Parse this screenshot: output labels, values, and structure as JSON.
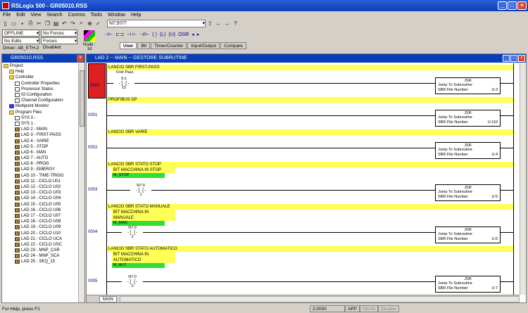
{
  "app": {
    "title": "RSLogix 500 - GR05010.RSS"
  },
  "menu": [
    "File",
    "Edit",
    "View",
    "Search",
    "Comms",
    "Tools",
    "Window",
    "Help"
  ],
  "toolbar": {
    "address": "N7:97/7"
  },
  "status": {
    "mode": "OFFLINE",
    "forces": "No Forces",
    "edits": "No Edits",
    "forces_state": "Forces Disabled",
    "node": "Node : 1d",
    "driver": "Driver: AB_ETH-2"
  },
  "instr_tabs": [
    "User",
    "Bit",
    "Timer/Counter",
    "Input/Output",
    "Compare"
  ],
  "project": {
    "title": "GR05010.RSS",
    "items": [
      {
        "label": "Project",
        "icon": "folder",
        "indent": 0
      },
      {
        "label": "Help",
        "icon": "folder",
        "indent": 1
      },
      {
        "label": "Controller",
        "icon": "folder",
        "indent": 1
      },
      {
        "label": "Controller Properties",
        "icon": "file",
        "indent": 2
      },
      {
        "label": "Processor Status",
        "icon": "file",
        "indent": 2
      },
      {
        "label": "IO Configuration",
        "icon": "file",
        "indent": 2
      },
      {
        "label": "Channel Configuration",
        "icon": "file",
        "indent": 2
      },
      {
        "label": "Multipoint Monitor",
        "icon": "mon",
        "indent": 1
      },
      {
        "label": "Program Files",
        "icon": "folder",
        "indent": 1
      },
      {
        "label": "SYS 0 -",
        "icon": "file",
        "indent": 2
      },
      {
        "label": "SYS 1 -",
        "icon": "file",
        "indent": 2
      },
      {
        "label": "LAD 2 - MAIN",
        "icon": "lad",
        "indent": 2
      },
      {
        "label": "LAD 3 - FIRST-PASS",
        "icon": "lad",
        "indent": 2
      },
      {
        "label": "LAD 4 - VARIE",
        "icon": "lad",
        "indent": 2
      },
      {
        "label": "LAD 5 - STOP",
        "icon": "lad",
        "indent": 2
      },
      {
        "label": "LAD 6 - MAN",
        "icon": "lad",
        "indent": 2
      },
      {
        "label": "LAD 7 - AUTO",
        "icon": "lad",
        "indent": 2
      },
      {
        "label": "LAD 8 - PROG",
        "icon": "lad",
        "indent": 2
      },
      {
        "label": "LAD 9 - EMERGY",
        "icon": "lad",
        "indent": 2
      },
      {
        "label": "LAD 10 - TIME-TRIGG",
        "icon": "lad",
        "indent": 2
      },
      {
        "label": "LAD 11 - CICLO U01",
        "icon": "lad",
        "indent": 2
      },
      {
        "label": "LAD 12 - CICLO U02",
        "icon": "lad",
        "indent": 2
      },
      {
        "label": "LAD 13 - CICLO U03",
        "icon": "lad",
        "indent": 2
      },
      {
        "label": "LAD 14 - CICLO U04",
        "icon": "lad",
        "indent": 2
      },
      {
        "label": "LAD 15 - CICLO U05",
        "icon": "lad",
        "indent": 2
      },
      {
        "label": "LAD 16 - CICLO U06",
        "icon": "lad",
        "indent": 2
      },
      {
        "label": "LAD 17 - CICLO U07",
        "icon": "lad",
        "indent": 2
      },
      {
        "label": "LAD 18 - CICLO U08",
        "icon": "lad",
        "indent": 2
      },
      {
        "label": "LAD 19 - CICLO U09",
        "icon": "lad",
        "indent": 2
      },
      {
        "label": "LAD 20 - CICLO U10",
        "icon": "lad",
        "indent": 2
      },
      {
        "label": "LAD 21 - CICLO UCA",
        "icon": "lad",
        "indent": 2
      },
      {
        "label": "LAD 22 - CICLO USC",
        "icon": "lad",
        "indent": 2
      },
      {
        "label": "LAD 23 - MNP_CAR",
        "icon": "lad",
        "indent": 2
      },
      {
        "label": "LAD 24 - MNP_SCA",
        "icon": "lad",
        "indent": 2
      },
      {
        "label": "LAD 25 - SEQ_15",
        "icon": "lad",
        "indent": 2
      }
    ]
  },
  "ladder": {
    "title": "LAD 2 -- MAIN -- GESTORE SUBRUTINE",
    "jsr_head": "JSR",
    "jsr_label": "Jump To Subroutine",
    "sbr_label": "SBR File Number",
    "rungs": [
      {
        "num": "0000",
        "comment": "LANCIO SBR FIRST-PASS",
        "contact_desc": "First Pass",
        "contact_addr": "S:1",
        "contact_bit": "15",
        "sbr": "U:3"
      },
      {
        "num": "0001",
        "comment": "PROFIBUS DP",
        "sbr": "U:110"
      },
      {
        "num": "0002",
        "comment": "LANCIO SBR VARIE",
        "sbr": "U:4"
      },
      {
        "num": "0003",
        "comment": "LANCIO SBR  STATO STOP",
        "sub1": "BIT MACCHINA IN STOP",
        "sym": "M_STOP",
        "contact_addr": "N7:0",
        "contact_bit": "1",
        "sbr": "U:5"
      },
      {
        "num": "0004",
        "comment": "LANCIO SBR STATO MANUALE",
        "sub1": "BIT MACCHINA IN",
        "sub2": "MANUALE",
        "sym": "M_MAN",
        "contact_addr": "N7:0",
        "contact_bit": "2",
        "sbr": "U:6"
      },
      {
        "num": "0005",
        "comment": "LANCIO SBR STATO AUTOMATICO",
        "sub1": "BIT MACCHINA IN",
        "sub2": "AUTOMATICO",
        "sym": "M_AUT",
        "contact_addr": "N7:0",
        "contact_bit": "3",
        "sbr": "U:7"
      }
    ]
  },
  "bottom_tab": "MAIN",
  "statusbar": {
    "help": "For Help, press F1",
    "pos": "2:0000",
    "app": "APP",
    "read": "READ",
    "disabled": "Disable"
  }
}
